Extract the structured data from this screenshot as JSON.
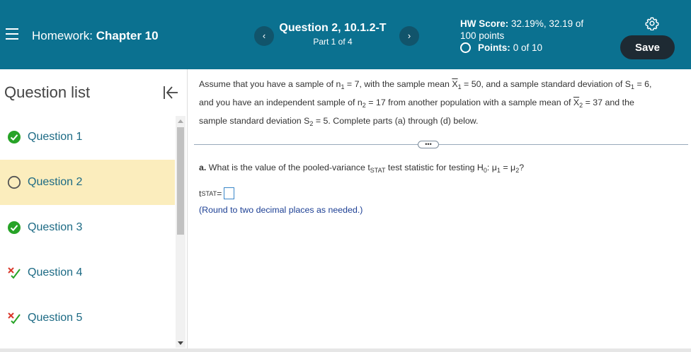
{
  "header": {
    "homework_prefix": "Homework:",
    "homework_name": "Chapter 10",
    "question_title": "Question 2, 10.1.2-T",
    "question_part": "Part 1 of 4",
    "prev_glyph": "‹",
    "next_glyph": "›",
    "hw_score_label": "HW Score:",
    "hw_score_value": "32.19%, 32.19 of",
    "hw_score_total": "100 points",
    "points_label": "Points:",
    "points_value": "0 of 10",
    "save_label": "Save"
  },
  "sidebar": {
    "title": "Question list",
    "items": [
      {
        "label": "Question 1",
        "status": "correct"
      },
      {
        "label": "Question 2",
        "status": "current"
      },
      {
        "label": "Question 3",
        "status": "correct"
      },
      {
        "label": "Question 4",
        "status": "partial"
      },
      {
        "label": "Question 5",
        "status": "partial"
      }
    ]
  },
  "problem": {
    "t1": "Assume that you have a sample of n",
    "s1": "1",
    "t2": " = 7, with the sample mean ",
    "xbar": "X",
    "s2": "1",
    "t3": " = 50, and a sample standard deviation of S",
    "s3": "1",
    "t4": " = 6,",
    "t5": "and you have an independent sample of n",
    "s4": "2",
    "t6": " = 17 from another population with a sample mean of ",
    "s5": "2",
    "t7": " = 37 and the",
    "t8": "sample standard deviation S",
    "s6": "2",
    "t9": " = 5. Complete parts (a) through (d) below."
  },
  "expand_label": "•••",
  "part_a": {
    "prefix": "a.",
    "q1": " What is the value of the pooled-variance t",
    "stat_sub": "STAT",
    "q2": " test statistic for testing H",
    "h_sub": "0",
    "q3": ": μ",
    "mu1": "1",
    "q4": " = μ",
    "mu2": "2",
    "q5": "?",
    "answer_var": "t",
    "answer_sub": "STAT",
    "answer_eq": " =",
    "hint": "(Round to two decimal places as needed.)"
  },
  "colors": {
    "header_bg": "#0b7190",
    "active_item_bg": "#fbedbd",
    "correct_green": "#27a327",
    "partial_red": "#d9382b",
    "link_blue": "#1c6a84"
  }
}
